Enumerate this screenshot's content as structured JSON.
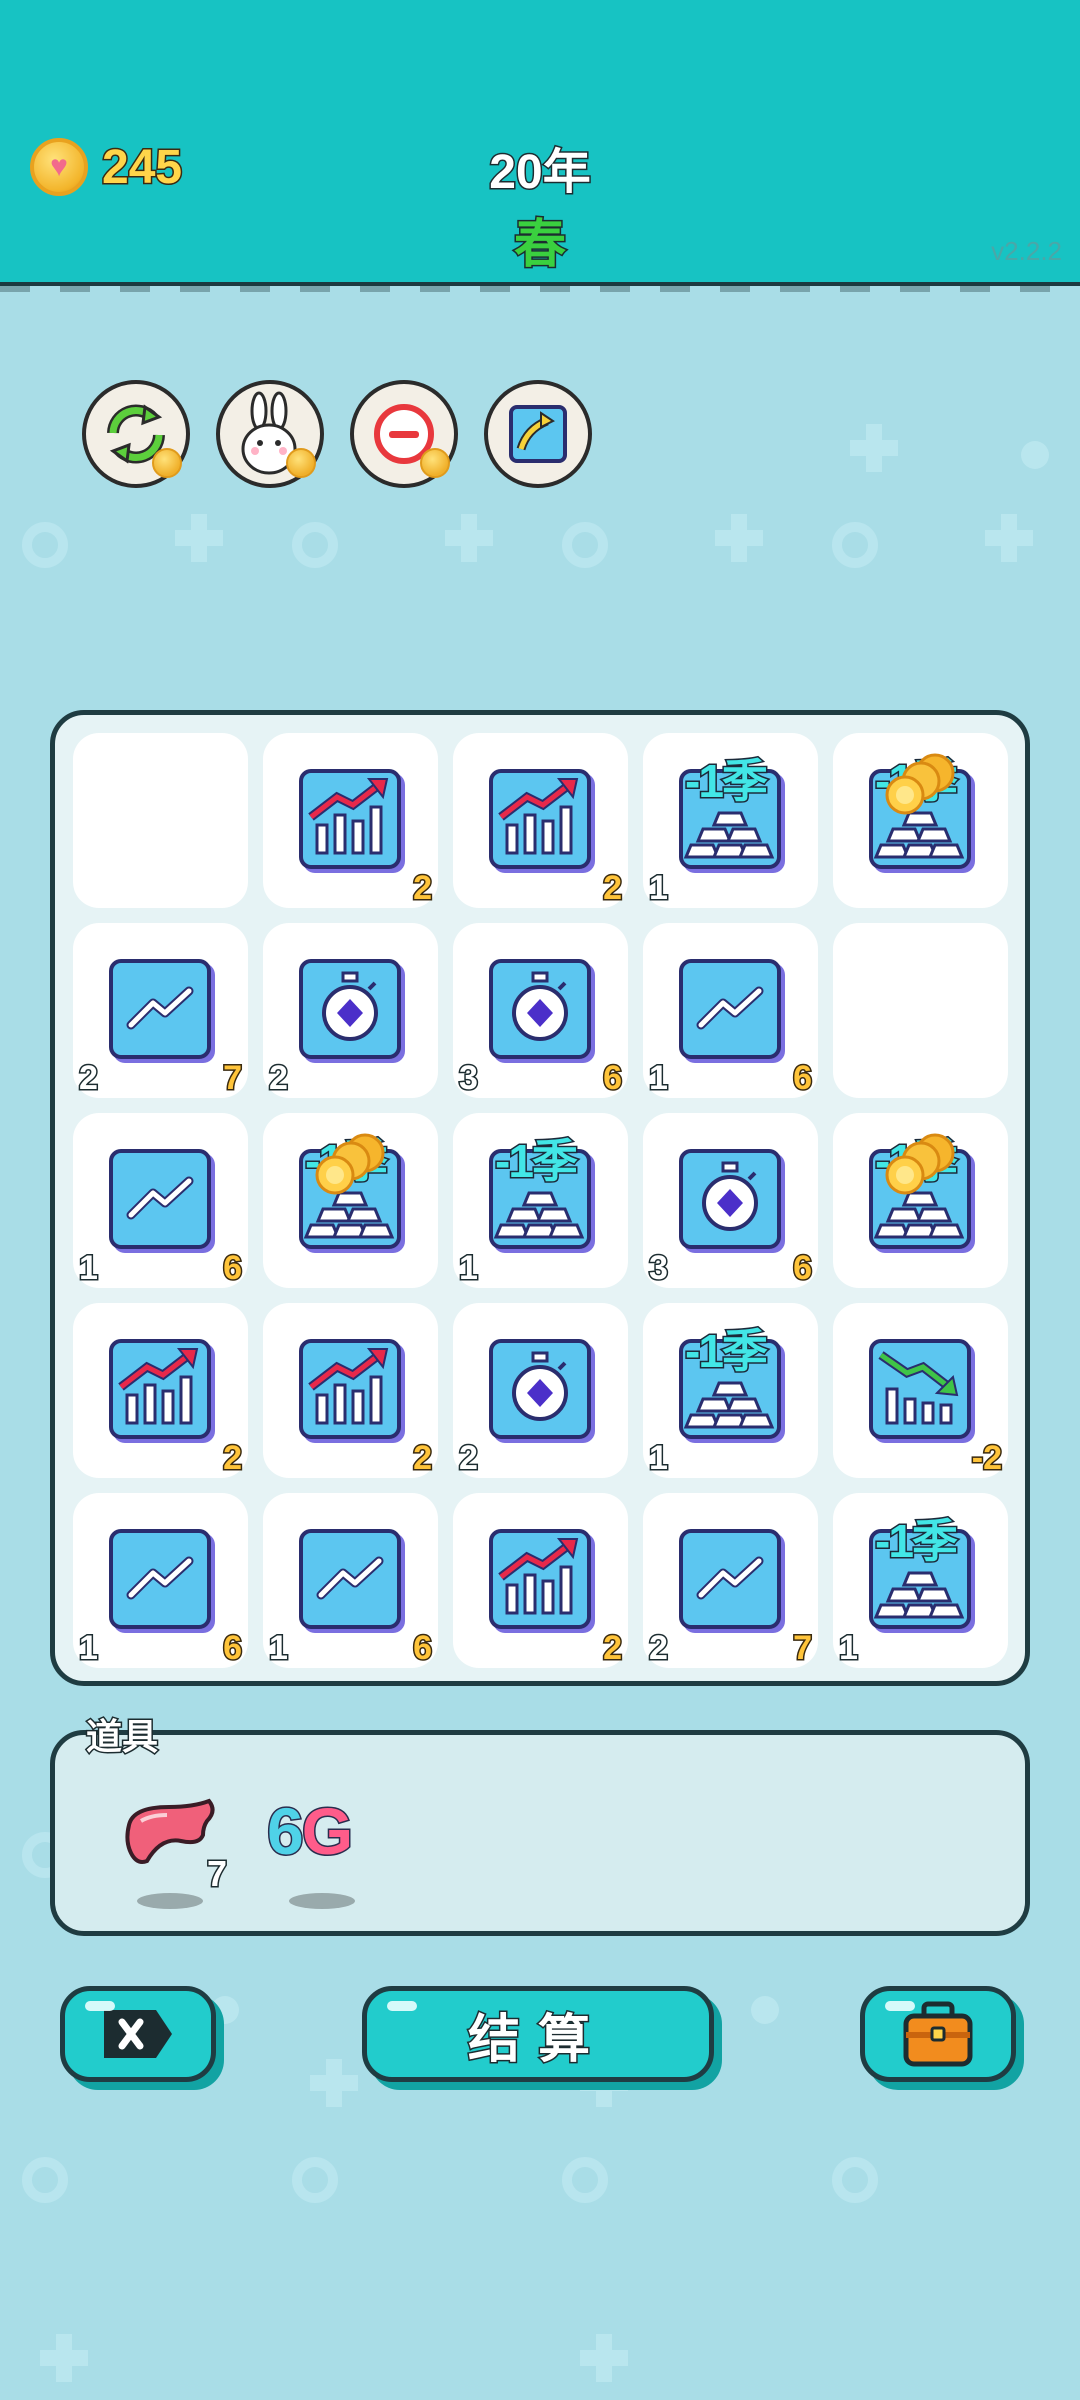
{
  "header": {
    "coins": "245",
    "year": "20年",
    "season": "春",
    "version": "v2.2.2"
  },
  "powerups": [
    {
      "name": "refresh",
      "icon": "refresh-icon"
    },
    {
      "name": "rabbit",
      "icon": "rabbit-icon"
    },
    {
      "name": "remove",
      "icon": "minus-icon"
    },
    {
      "name": "upgrade",
      "icon": "arrow-up-icon"
    }
  ],
  "board": {
    "cells": [
      {
        "tile": "empty"
      },
      {
        "tile": "bar-up",
        "left": "",
        "right": "2"
      },
      {
        "tile": "bar-up",
        "left": "",
        "right": "2"
      },
      {
        "tile": "gold",
        "left": "1",
        "right": "",
        "tag": "-1季"
      },
      {
        "tile": "gold-coins",
        "left": "",
        "right": "",
        "tag": "-1季"
      },
      {
        "tile": "line",
        "left": "2",
        "right": "7"
      },
      {
        "tile": "timer",
        "left": "2",
        "right": ""
      },
      {
        "tile": "timer",
        "left": "3",
        "right": "6"
      },
      {
        "tile": "line",
        "left": "1",
        "right": "6"
      },
      {
        "tile": "empty"
      },
      {
        "tile": "line",
        "left": "1",
        "right": "6"
      },
      {
        "tile": "gold-coins",
        "left": "",
        "right": "",
        "tag": "-1季"
      },
      {
        "tile": "gold",
        "left": "1",
        "right": "",
        "tag": "-1季"
      },
      {
        "tile": "timer",
        "left": "3",
        "right": "6"
      },
      {
        "tile": "gold-coins",
        "left": "",
        "right": "",
        "tag": "-1季"
      },
      {
        "tile": "bar-up",
        "left": "",
        "right": "2"
      },
      {
        "tile": "bar-up",
        "left": "",
        "right": "2"
      },
      {
        "tile": "timer",
        "left": "2",
        "right": ""
      },
      {
        "tile": "gold",
        "left": "1",
        "right": "",
        "tag": "-1季"
      },
      {
        "tile": "bar-down",
        "left": "",
        "right": "-2"
      },
      {
        "tile": "line",
        "left": "1",
        "right": "6"
      },
      {
        "tile": "line",
        "left": "1",
        "right": "6"
      },
      {
        "tile": "bar-up",
        "left": "",
        "right": "2"
      },
      {
        "tile": "line",
        "left": "2",
        "right": "7"
      },
      {
        "tile": "gold",
        "left": "1",
        "right": "",
        "tag": "-1季"
      }
    ]
  },
  "props": {
    "label": "道具",
    "items": [
      {
        "name": "liver",
        "icon": "liver-icon",
        "count": "7"
      },
      {
        "name": "6g",
        "text_a": "6",
        "text_b": "G"
      }
    ]
  },
  "buttons": {
    "close_icon": "close-tag-icon",
    "settle_label": "结算",
    "bag_icon": "briefcase-icon"
  },
  "colors": {
    "header": "#17c3c3",
    "background": "#a9dde7",
    "tile": "#5cc6f0",
    "button": "#22cccc"
  }
}
